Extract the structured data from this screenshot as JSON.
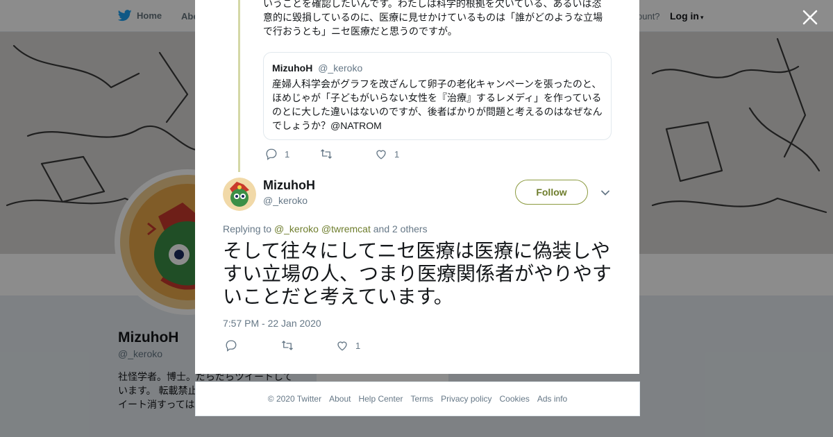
{
  "nav": {
    "home": "Home",
    "about": "Abo",
    "account_prompt": "ccount?",
    "login": "Log in"
  },
  "profile": {
    "name": "MizuhoH",
    "handle": "@_keroko",
    "bio": "社怪学者。博士。だらだらツイートして います。 転載禁止 たち」(青弓社)ア らツイート消すっては。"
  },
  "previous_tweet": {
    "text": "いうことを確認したいんです。わたしは科学的根拠を欠いている、あるいは恣意的に毀損しているのに、医療に見せかけているものは「誰がどのような立場で行おうとも」ニセ医療だと思うのですが。",
    "quote": {
      "name": "MizuhoH",
      "handle": "@_keroko",
      "text": "産婦人科学会がグラフを改ざんして卵子の老化キャンペーンを張ったのと、ほめじゃが「子どもがいらない女性を『治療』するレメディ」を作っているのとに大した違いはないのですが、後者ばかりが問題と考えるのはなぜなんでしょうか？@NATROM"
    },
    "actions": {
      "replies": "1",
      "retweets": "",
      "likes": "1"
    }
  },
  "tweet": {
    "author_name": "MizuhoH",
    "author_handle": "@_keroko",
    "follow_label": "Follow",
    "replying_prefix": "Replying to",
    "reply_mention_1": "@_keroko",
    "reply_mention_2": "@twremcat",
    "reply_suffix": "and 2 others",
    "text": "そして往々にしてニセ医療は医療に偽装しやすい立場の人、つまり医療関係者がやりやすいことだと考えています。",
    "timestamp": "7:57 PM - 22 Jan 2020",
    "actions": {
      "replies": "",
      "retweets": "",
      "likes": "1"
    }
  },
  "footer": {
    "copyright": "© 2020 Twitter",
    "about": "About",
    "help": "Help Center",
    "terms": "Terms",
    "privacy": "Privacy policy",
    "cookies": "Cookies",
    "ads": "Ads info"
  },
  "icons": {
    "brand": "twitter-bird-icon",
    "close": "close-icon",
    "reply": "reply-icon",
    "retweet": "retweet-icon",
    "like": "heart-icon",
    "caret": "chevron-down-icon"
  },
  "colors": {
    "brand_blue": "#1da1f2",
    "profile_accent": "#6e7d2c",
    "thread_line": "#d4d8a6"
  }
}
